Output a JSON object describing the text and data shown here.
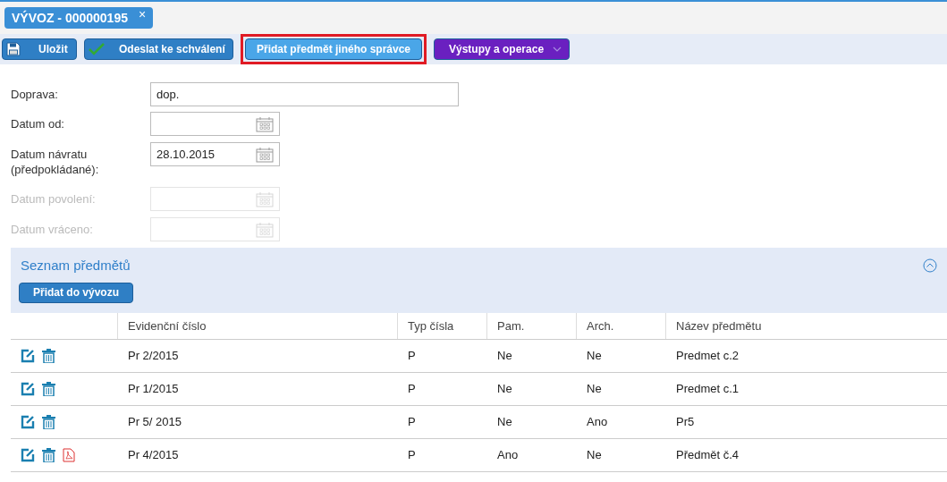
{
  "tab": {
    "title": "VÝVOZ - 000000195",
    "close": "×",
    "selected": true
  },
  "toolbar": [
    {
      "label": "Uložit",
      "kind": "save",
      "highlighted": false
    },
    {
      "label": "Odeslat ke schválení",
      "kind": "approve",
      "highlighted": false
    },
    {
      "label": "Přidat předmět jiného správce",
      "kind": "plain",
      "highlighted": true
    },
    {
      "label": "Výstupy a operace",
      "kind": "menu",
      "highlighted": false
    }
  ],
  "form": [
    {
      "label": "Doprava:",
      "kind": "text",
      "value": "dop.",
      "disabled": false
    },
    {
      "label": "Datum od:",
      "kind": "date",
      "disabled": false
    },
    {
      "label": "Datum návratu (předpokládané):",
      "kind": "date",
      "value": "28.10.2015",
      "disabled": false
    },
    {
      "label": "Datum povolení:",
      "kind": "date",
      "disabled": true
    },
    {
      "label": "Datum vráceno:",
      "kind": "date",
      "disabled": true
    }
  ],
  "section": {
    "title": "Seznam předmětů",
    "expanded": true,
    "add_button": "Přidat do vývozu"
  },
  "table": {
    "columns": [
      "Evidenční číslo",
      "Typ čísla",
      "Pam.",
      "Arch.",
      "Název předmětu"
    ],
    "rows": [
      {
        "pdf": false,
        "cells": [
          "Pr 2/2015",
          "P",
          "Ne",
          "Ne",
          "Predmet c.2"
        ]
      },
      {
        "pdf": false,
        "cells": [
          "Pr 1/2015",
          "P",
          "Ne",
          "Ne",
          "Predmet c.1"
        ]
      },
      {
        "pdf": false,
        "cells": [
          "Pr 5/ 2015",
          "P",
          "Ne",
          "Ano",
          "Pr5"
        ]
      },
      {
        "pdf": true,
        "cells": [
          "Pr 4/2015",
          "P",
          "Ano",
          "Ne",
          "Předmět č.4"
        ]
      }
    ]
  }
}
